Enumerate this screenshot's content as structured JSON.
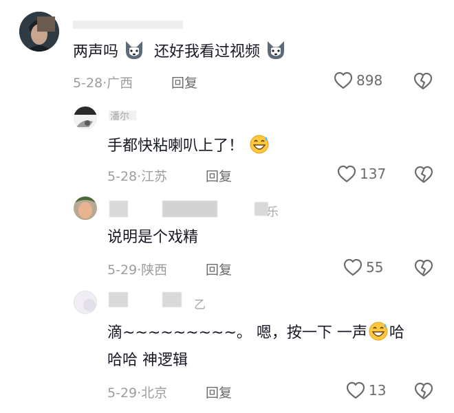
{
  "comments": [
    {
      "name_fragment": "",
      "text": "两声吗",
      "text_after": "还好我看过视频",
      "date": "5-28",
      "region": "广西",
      "reply": "回复",
      "likes": "898",
      "icons": {
        "emoji": "husky-dog-face-icon",
        "like": "heart-icon",
        "dislike": "broken-heart-icon"
      }
    },
    {
      "name_fragment": "潘尔",
      "text": "手都快粘喇叭上了！",
      "date": "5-28",
      "region": "江苏",
      "reply": "回复",
      "likes": "137",
      "icons": {
        "emoji": "grinning-sweat-face-icon"
      }
    },
    {
      "name_fragment": "乐",
      "text": "说明是个戏精",
      "date": "5-29",
      "region": "陕西",
      "reply": "回复",
      "likes": "55"
    },
    {
      "name_fragment": "乙",
      "text_line1_a": "滴~~~~~~~~~。 嗯，按一下 一声",
      "text_line1_b": "哈",
      "text_line2": "哈哈 神逻辑",
      "date": "5-29",
      "region": "北京",
      "reply": "回复",
      "likes": "13"
    }
  ],
  "separator": "·",
  "colors": {
    "text": "#161823",
    "meta": "#9d9d9d",
    "action": "#6b6b6b"
  }
}
